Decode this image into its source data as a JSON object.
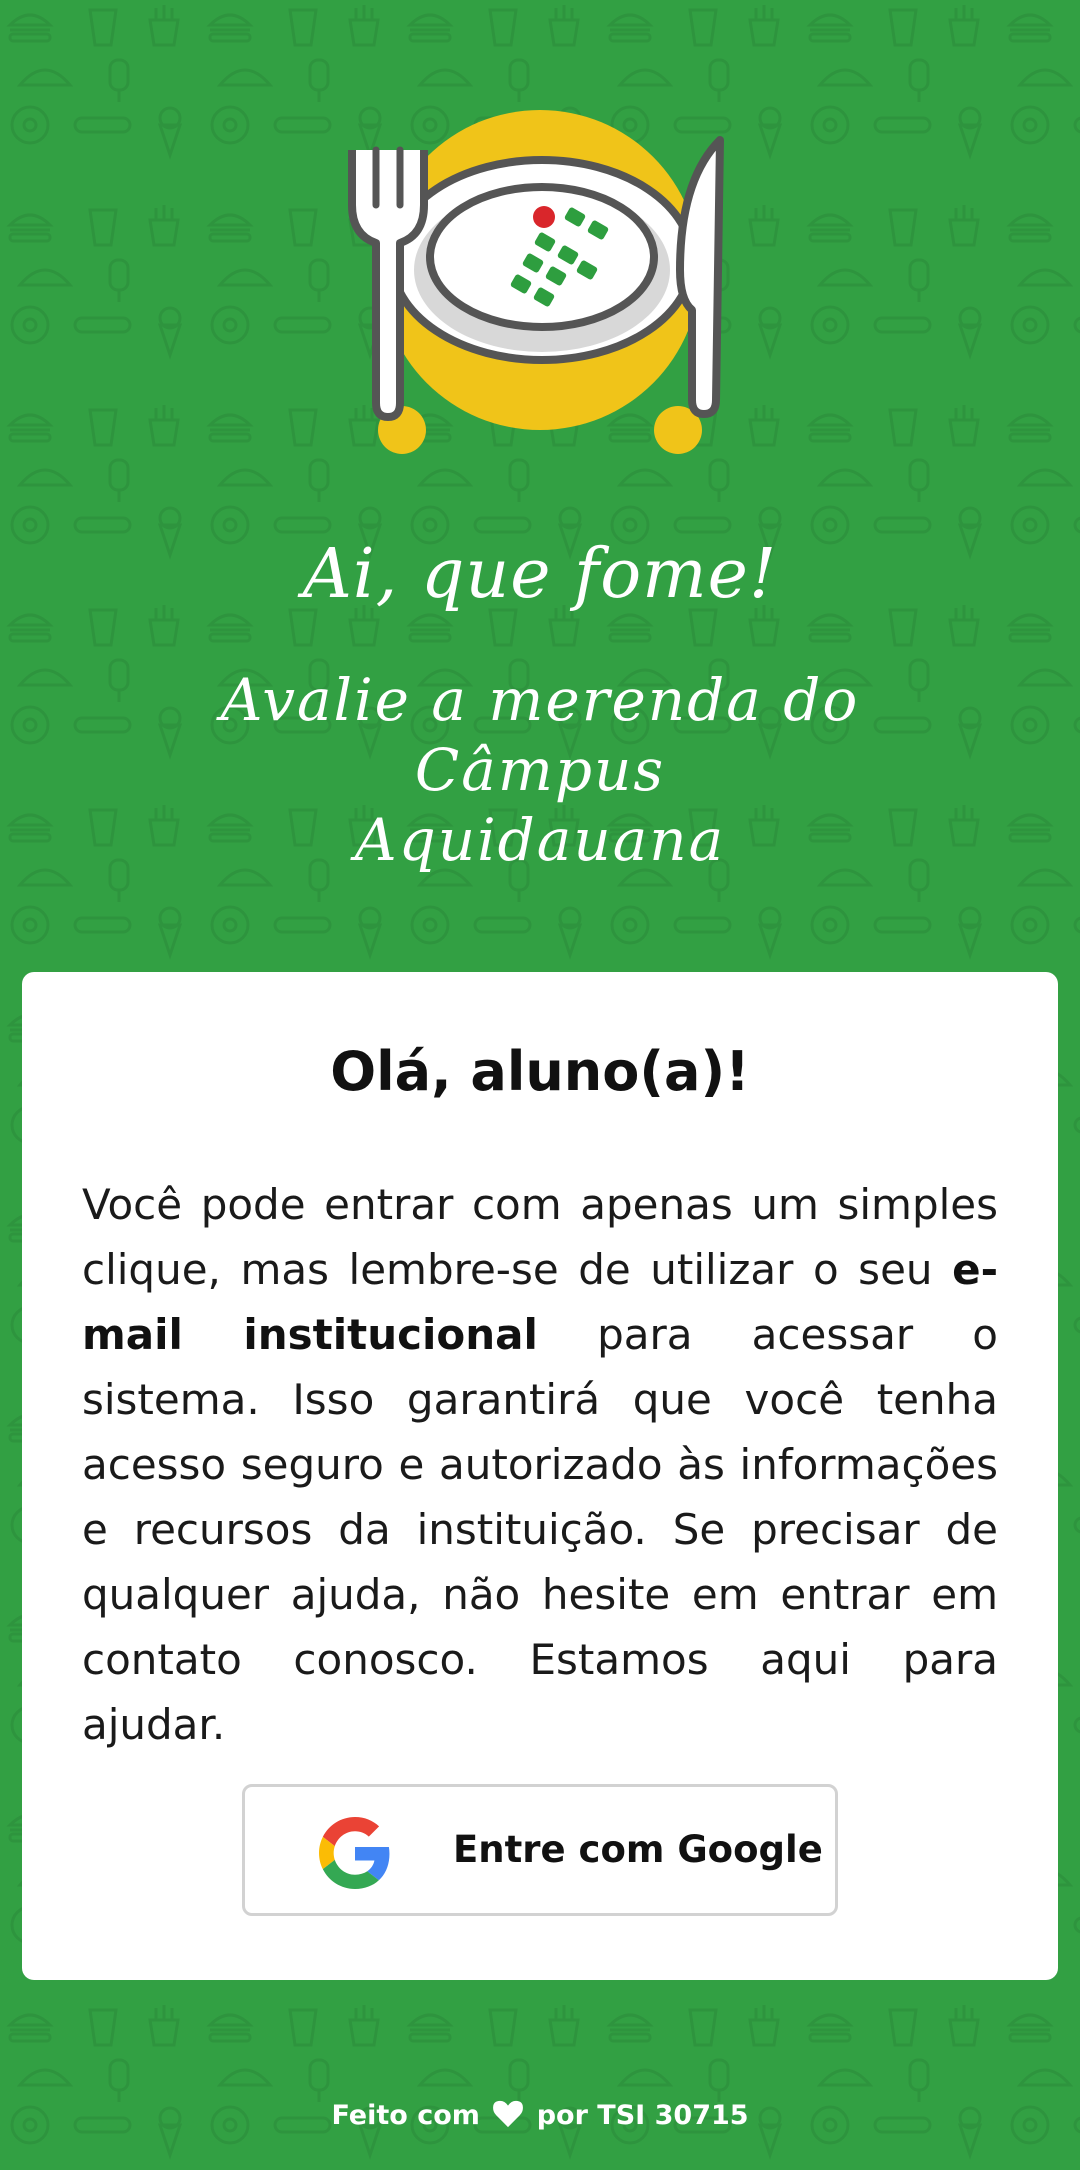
{
  "hero": {
    "app_title": "Ai, que fome!",
    "subtitle_line1": "Avalie a merenda do Câmpus",
    "subtitle_line2": "Aquidauana",
    "logo_icon": "plate-fork-knife-icon"
  },
  "card": {
    "title": "Olá, aluno(a)!",
    "text_before": "Você pode entrar com apenas um simples clique, mas lembre-se de utilizar o seu ",
    "text_bold": "e-mail institucional",
    "text_after": " para acessar o sistema. Isso garantirá que você tenha acesso seguro e autorizado às informações e recursos da instituição. Se precisar de qualquer ajuda, não hesite em entrar em contato conosco. Estamos aqui para ajudar.",
    "login_button_label": "Entre com Google",
    "login_button_icon": "google-icon"
  },
  "footer": {
    "prefix": "Feito com",
    "icon": "heart-icon",
    "suffix": "por TSI 30715"
  },
  "colors": {
    "background": "#32a043",
    "plate_circle": "#f0c419",
    "card": "#ffffff",
    "ifms_green": "#2e9e3f",
    "ifms_red": "#d9262b"
  }
}
